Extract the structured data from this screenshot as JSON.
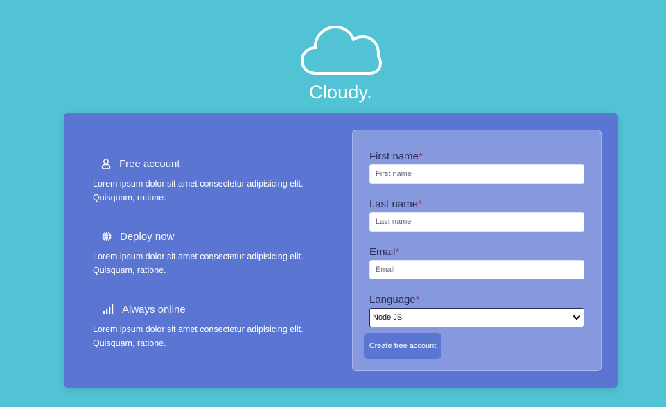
{
  "brand": {
    "name": "Cloudy.",
    "logo_icon": "cloud-icon"
  },
  "features": [
    {
      "icon": "user-icon",
      "title": "Free account",
      "description": "Lorem ipsum dolor sit amet consectetur adipisicing elit. Quisquam, ratione."
    },
    {
      "icon": "globe-icon",
      "title": "Deploy now",
      "description": "Lorem ipsum dolor sit amet consectetur adipisicing elit. Quisquam, ratione."
    },
    {
      "icon": "signal-icon",
      "title": "Always online",
      "description": "Lorem ipsum dolor sit amet consectetur adipisicing elit. Quisquam, ratione."
    }
  ],
  "form": {
    "required_marker": "*",
    "first_name": {
      "label": "First name",
      "placeholder": "First name",
      "value": ""
    },
    "last_name": {
      "label": "Last name",
      "placeholder": "Last name",
      "value": ""
    },
    "email": {
      "label": "Email",
      "placeholder": "Email",
      "value": ""
    },
    "language": {
      "label": "Language",
      "selected": "Node JS"
    },
    "submit_label": "Create free account"
  },
  "colors": {
    "background": "#52c3d4",
    "card": "#5a76d2",
    "form_panel": "#8699de",
    "required": "#e5134a"
  }
}
